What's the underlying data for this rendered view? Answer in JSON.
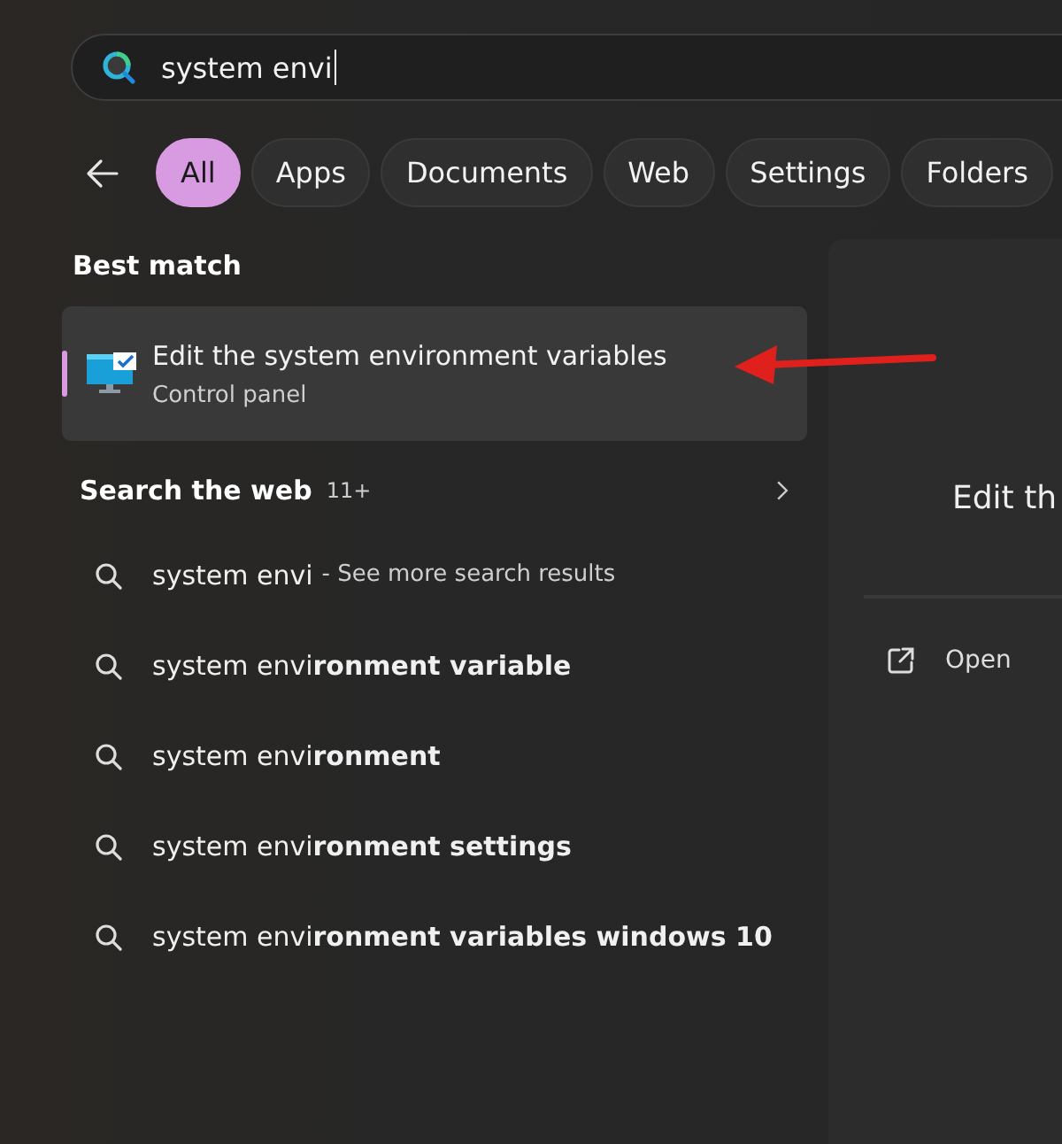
{
  "search": {
    "value": "system envi"
  },
  "filters": [
    {
      "label": "All",
      "selected": true
    },
    {
      "label": "Apps",
      "selected": false
    },
    {
      "label": "Documents",
      "selected": false
    },
    {
      "label": "Web",
      "selected": false
    },
    {
      "label": "Settings",
      "selected": false
    },
    {
      "label": "Folders",
      "selected": false
    }
  ],
  "best_match": {
    "heading": "Best match",
    "title": "Edit the system environment variables",
    "subtitle": "Control panel",
    "selected": true
  },
  "web": {
    "heading": "Search the web",
    "count": "11+",
    "suggestions": [
      {
        "text": "system envi",
        "hint": "- See more search results"
      },
      {
        "text": "system envi**ronment variable**"
      },
      {
        "text": "system envi**ronment**"
      },
      {
        "text": "system envi**ronment settings**"
      },
      {
        "text": "system envi**ronment variables windows 10**"
      }
    ]
  },
  "preview": {
    "title": "Edit th",
    "actions": [
      {
        "label": "Open"
      }
    ]
  }
}
